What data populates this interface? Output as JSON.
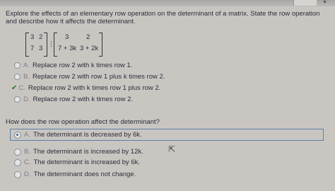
{
  "prompt": "Explore the effects of an elementary row operation on the determinant of a matrix. State the row operation and describe how it affects the determinant.",
  "matrix_a": [
    [
      "3",
      "2"
    ],
    [
      "7",
      "3"
    ]
  ],
  "matrix_b": [
    [
      "3",
      "2"
    ],
    [
      "7 + 3k",
      "3 + 2k"
    ]
  ],
  "row_options": [
    {
      "letter": "A.",
      "text": "Replace row 2 with k times row 1."
    },
    {
      "letter": "B.",
      "text": "Replace row 2 with row 1 plus k times row 2."
    },
    {
      "letter": "C.",
      "text": "Replace row 2 with k times row 1 plus row 2."
    },
    {
      "letter": "D.",
      "text": "Replace row 2 with k times row 2."
    }
  ],
  "question": "How does the row operation affect the determinant?",
  "answer_options": [
    {
      "letter": "A.",
      "text": "The determinant is decreased by 6k."
    },
    {
      "letter": "B.",
      "text": "The determinant is increased by 12k."
    },
    {
      "letter": "C.",
      "text": "The determinant is increased by 6k."
    },
    {
      "letter": "D.",
      "text": "The determinant does not change."
    }
  ],
  "colors": {
    "selected_outline": "#5b7fa5",
    "correct_check": "#2e6f2f"
  },
  "icons": {
    "correct_mark": "check-icon",
    "cursor": "mouse-cursor-icon"
  }
}
